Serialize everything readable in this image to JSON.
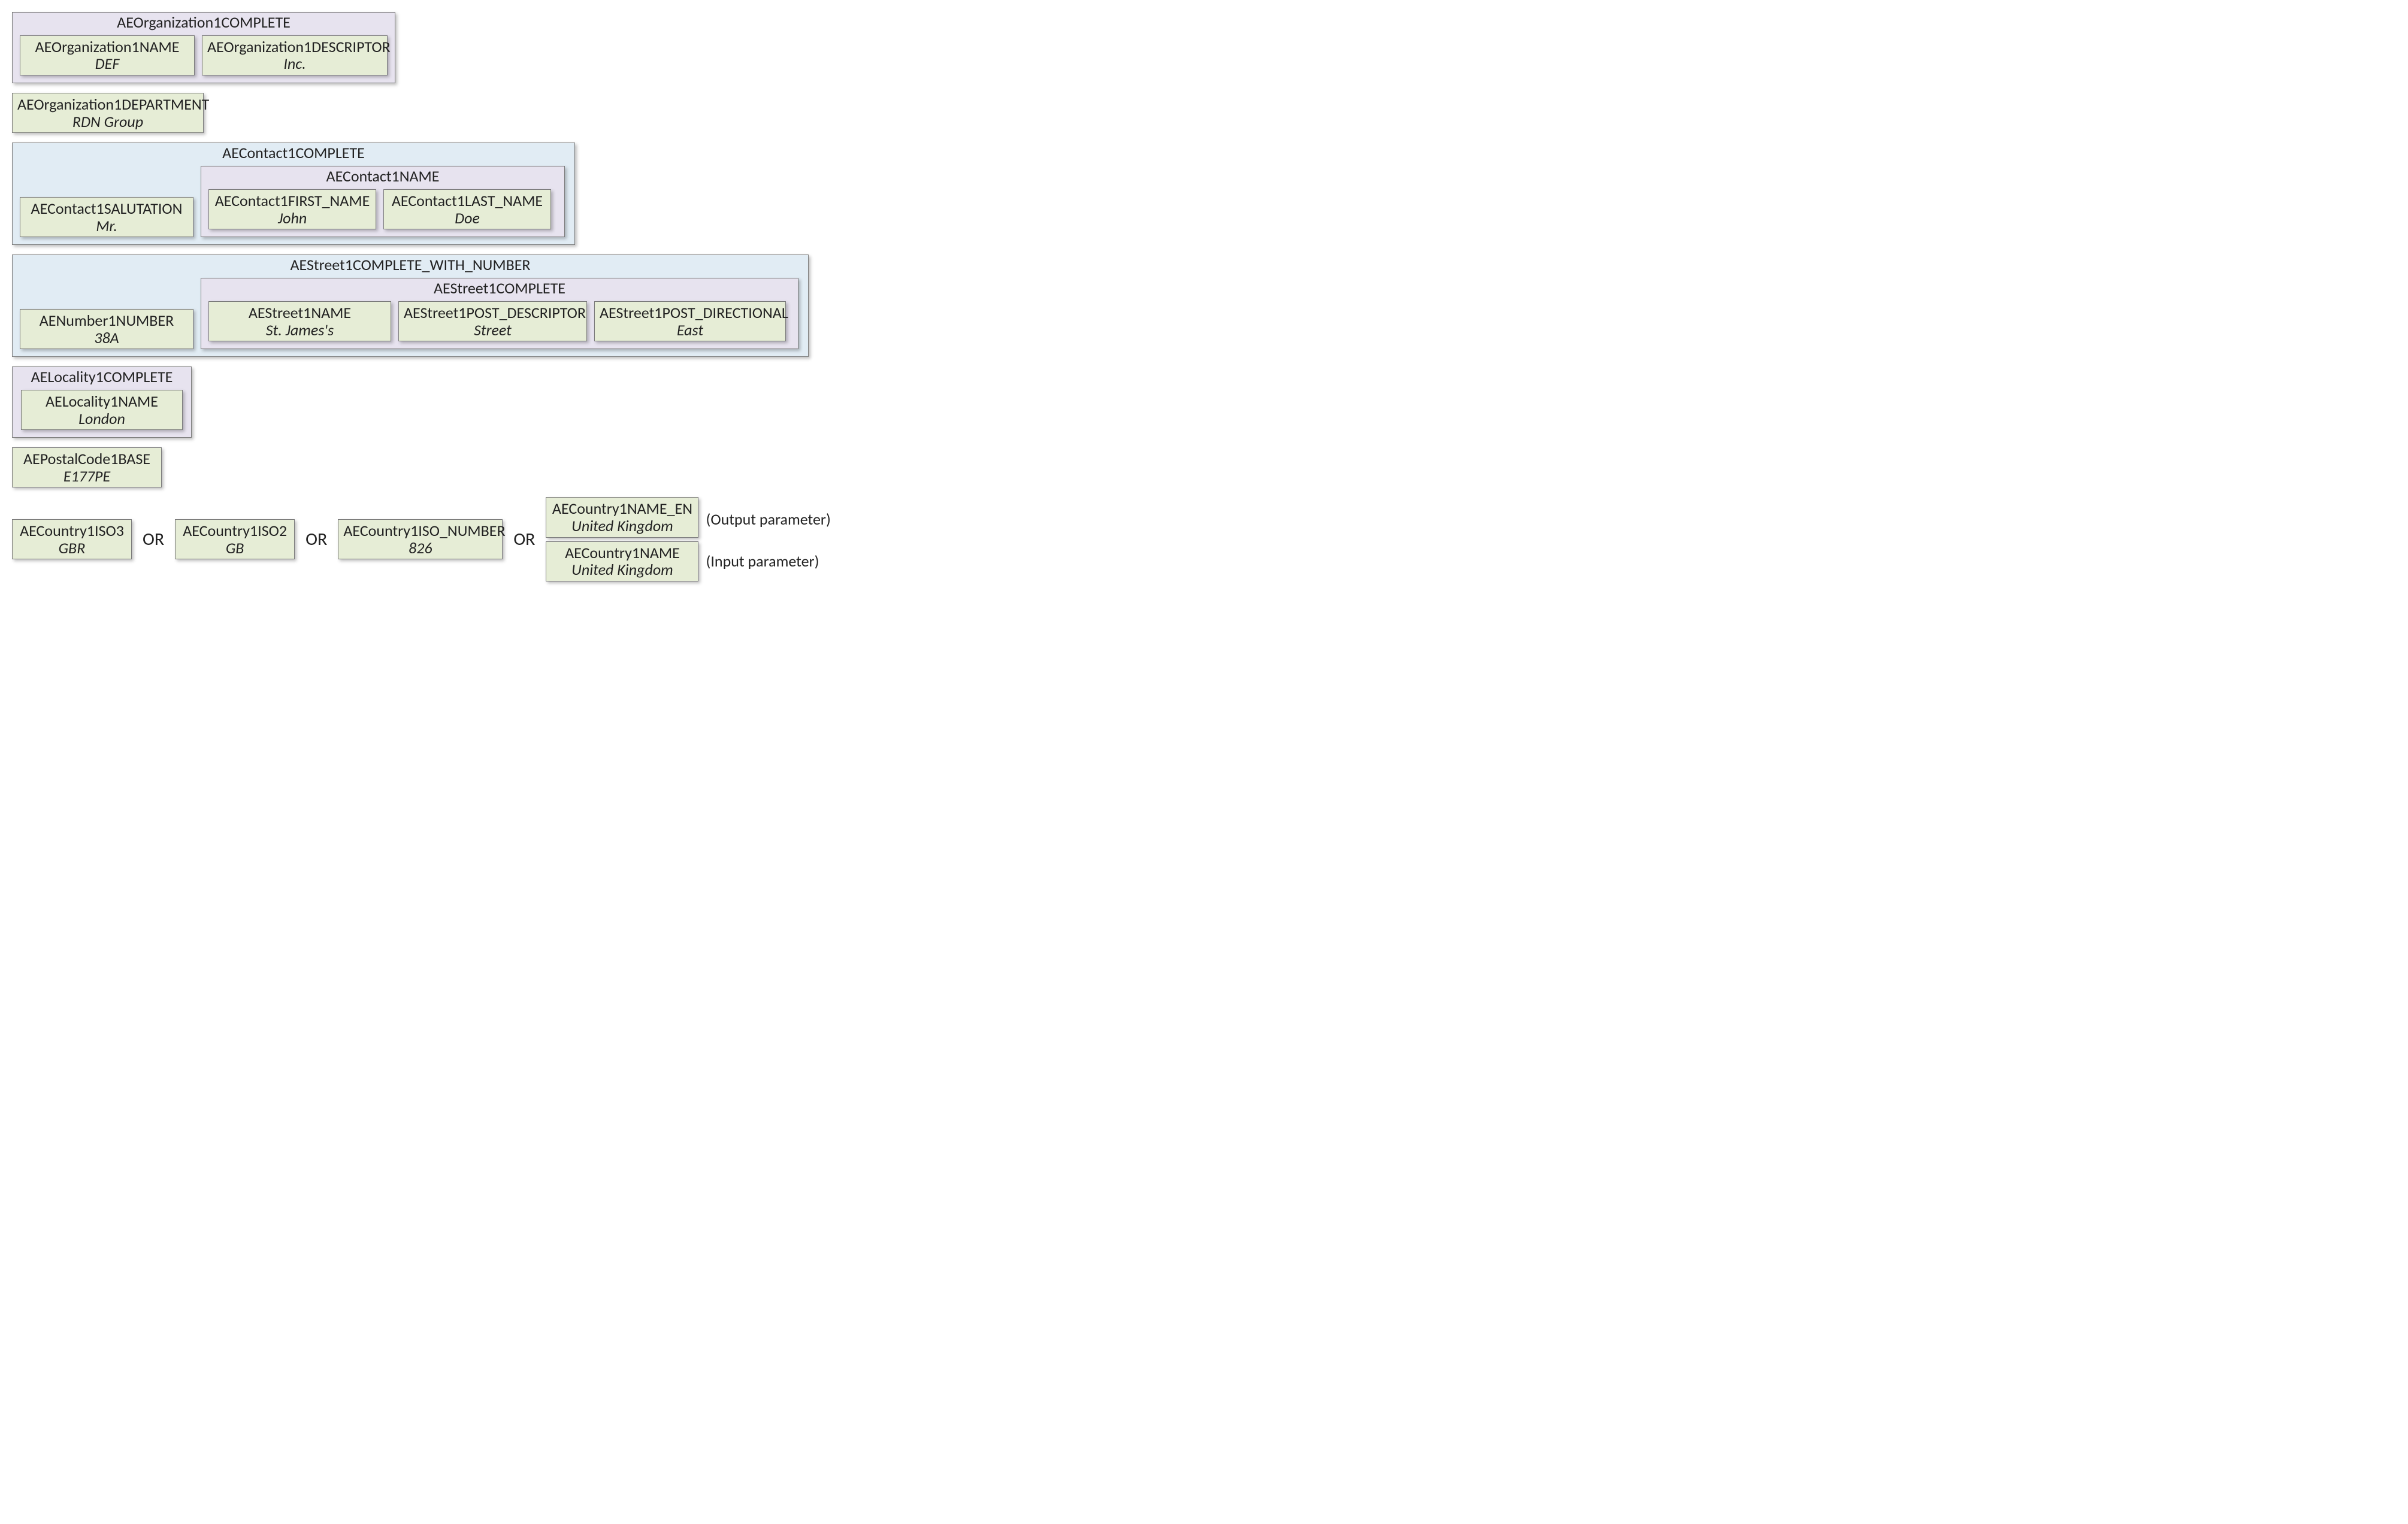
{
  "org": {
    "complete": "AEOrganization1COMPLETE",
    "name": {
      "label": "AEOrganization1NAME",
      "value": "DEF"
    },
    "descriptor": {
      "label": "AEOrganization1DESCRIPTOR",
      "value": "Inc."
    },
    "department": {
      "label": "AEOrganization1DEPARTMENT",
      "value": "RDN Group"
    }
  },
  "contact": {
    "complete": "AEContact1COMPLETE",
    "name_group": "AEContact1NAME",
    "salutation": {
      "label": "AEContact1SALUTATION",
      "value": "Mr."
    },
    "first": {
      "label": "AEContact1FIRST_NAME",
      "value": "John"
    },
    "last": {
      "label": "AEContact1LAST_NAME",
      "value": "Doe"
    }
  },
  "street": {
    "complete_with_number": "AEStreet1COMPLETE_WITH_NUMBER",
    "complete": "AEStreet1COMPLETE",
    "number": {
      "label": "AENumber1NUMBER",
      "value": "38A"
    },
    "name": {
      "label": "AEStreet1NAME",
      "value": "St. James's"
    },
    "post_descriptor": {
      "label": "AEStreet1POST_DESCRIPTOR",
      "value": "Street"
    },
    "post_directional": {
      "label": "AEStreet1POST_DIRECTIONAL",
      "value": "East"
    }
  },
  "locality": {
    "complete": "AELocality1COMPLETE",
    "name": {
      "label": "AELocality1NAME",
      "value": "London"
    }
  },
  "postal": {
    "label": "AEPostalCode1BASE",
    "value": "E177PE"
  },
  "country": {
    "iso3": {
      "label": "AECountry1ISO3",
      "value": "GBR"
    },
    "iso2": {
      "label": "AECountry1ISO2",
      "value": "GB"
    },
    "iso_number": {
      "label": "AECountry1ISO_NUMBER",
      "value": "826"
    },
    "name_en": {
      "label": "AECountry1NAME_EN",
      "value": "United Kingdom"
    },
    "name": {
      "label": "AECountry1NAME",
      "value": "United Kingdom"
    }
  },
  "words": {
    "or": "OR",
    "output_param": "(Output parameter)",
    "input_param": "(Input parameter)"
  }
}
